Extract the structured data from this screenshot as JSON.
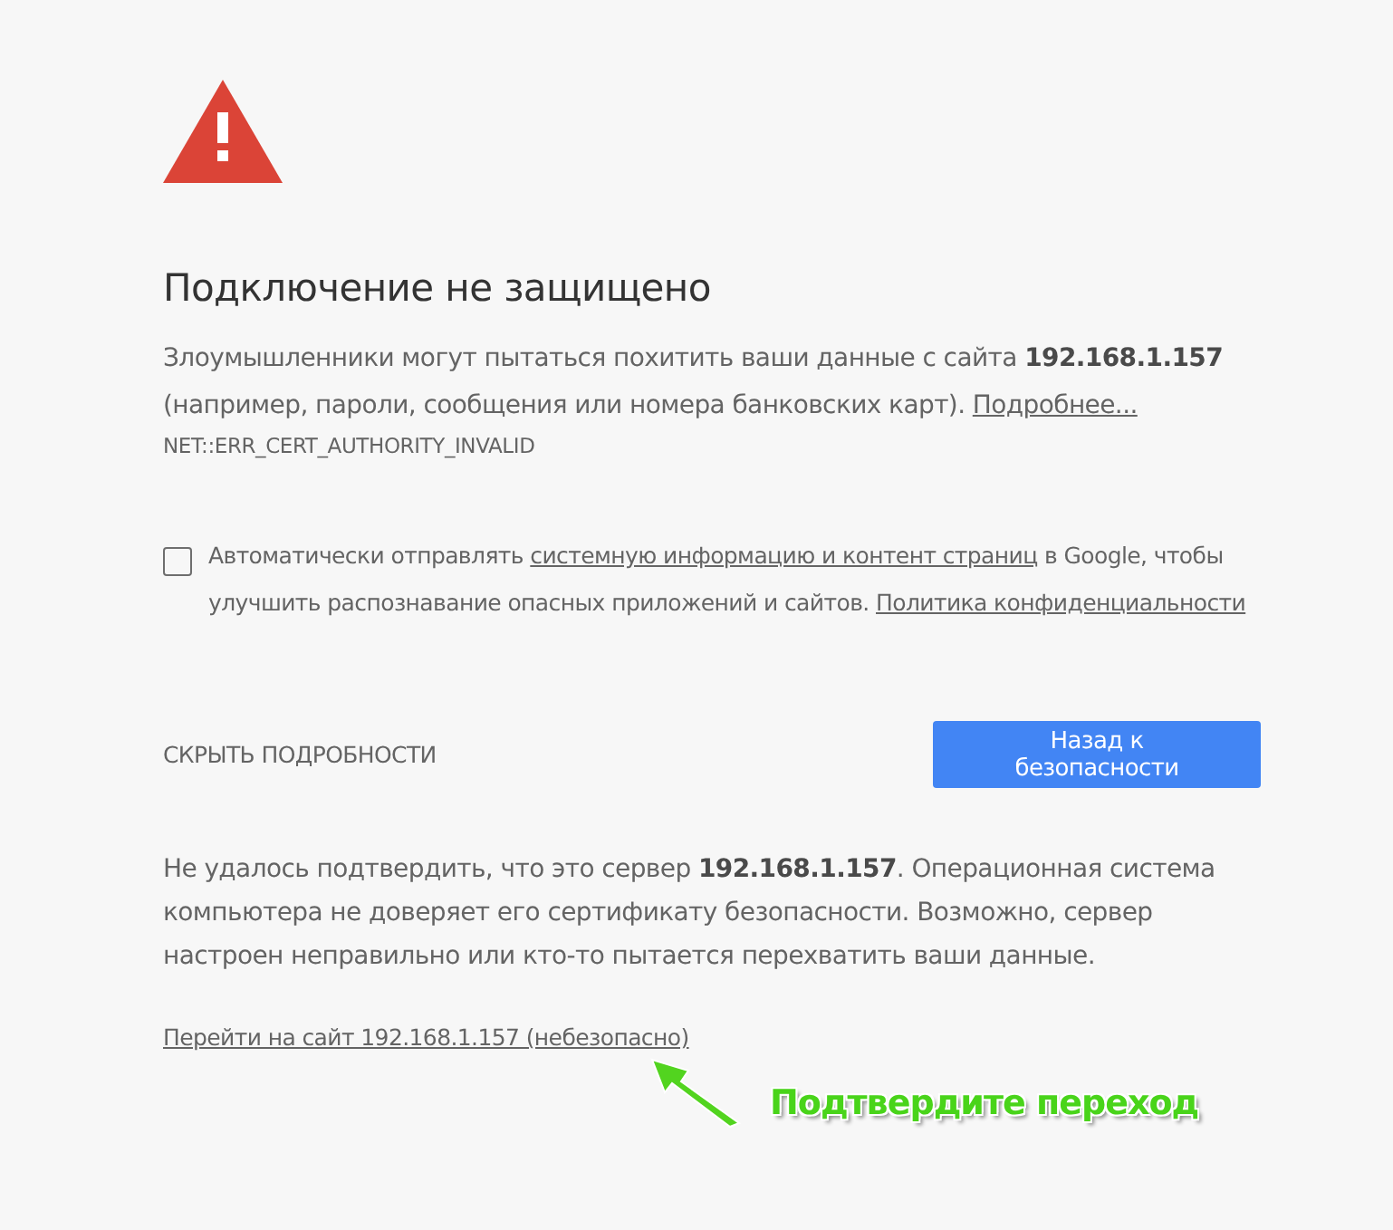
{
  "heading": "Подключение не защищено",
  "warning": {
    "text_before": "Злоумышленники могут пытаться похитить ваши данные с сайта **192.168.1.157** (например, пароли, сообщения или номера банковских карт).",
    "link": "Подробнее..."
  },
  "error_code": "NET::ERR_CERT_AUTHORITY_INVALID",
  "report_option": {
    "checked": false,
    "text_1": "Автоматически отправлять",
    "link_1": "системную информацию и контент страниц",
    "text_2": "в Google, чтобы улучшить распознавание опасных приложений и сайтов.",
    "link_2": "Политика конфиденциальности"
  },
  "details_toggle": "СКРЫТЬ ПОДРОБНОСТИ",
  "back_button": "Назад к безопасности",
  "details_text": "Не удалось подтвердить, что это сервер **192.168.1.157**. Операционная система компьютера не доверяет его сертификату безопасности. Возможно, сервер настроен неправильно или кто-то пытается перехватить ваши данные.",
  "proceed_link": "Перейти на сайт 192.168.1.157 (небезопасно)",
  "annotation": "Подтвердите переход"
}
